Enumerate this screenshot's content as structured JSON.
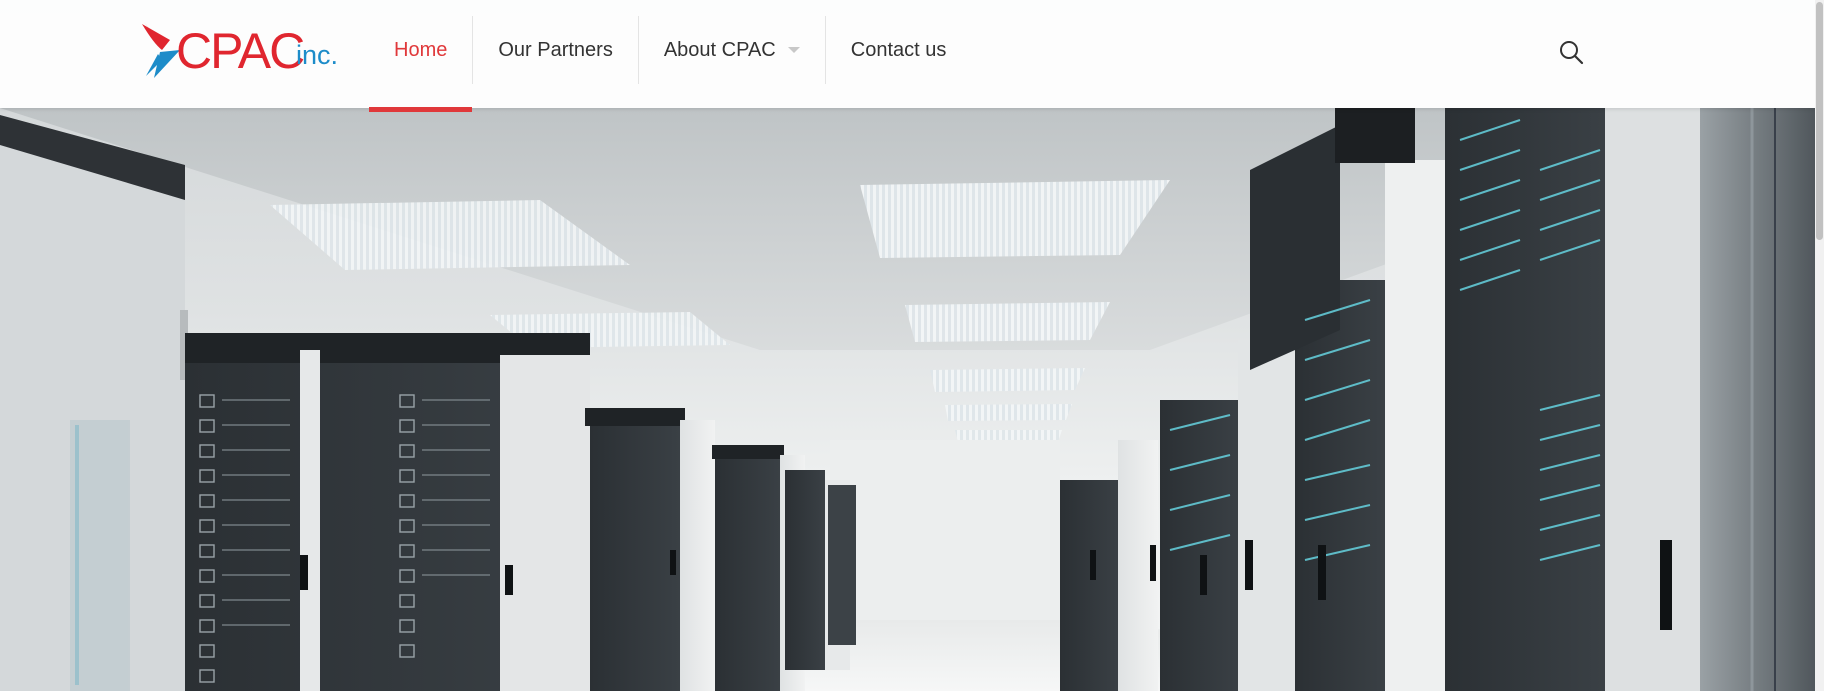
{
  "brand": {
    "logo_main": "CPAC",
    "logo_suffix": "inc.",
    "colors": {
      "red": "#e0262f",
      "blue": "#1d8cc9"
    }
  },
  "nav": {
    "items": [
      {
        "label": "Home",
        "active": true
      },
      {
        "label": "Our Partners",
        "active": false
      },
      {
        "label": "About CPAC",
        "active": false,
        "has_dropdown": true
      },
      {
        "label": "Contact us",
        "active": false
      }
    ],
    "active_color": "#e0383a"
  },
  "header": {
    "search_icon": "search-icon"
  },
  "hero": {
    "image": "server-room"
  }
}
